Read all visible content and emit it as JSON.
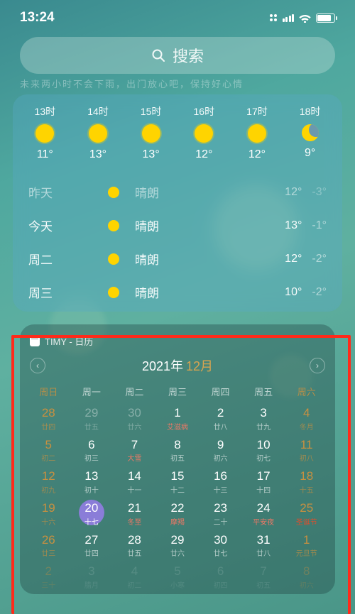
{
  "status": {
    "time": "13:24"
  },
  "search": {
    "placeholder": "搜索"
  },
  "weather": {
    "faded": "未来两小时不会下雨，出门放心吧，保持好心情",
    "hourly": [
      {
        "t": "13时",
        "temp": "11°",
        "icon": "sun"
      },
      {
        "t": "14时",
        "temp": "13°",
        "icon": "sun"
      },
      {
        "t": "15时",
        "temp": "13°",
        "icon": "sun"
      },
      {
        "t": "16时",
        "temp": "12°",
        "icon": "sun"
      },
      {
        "t": "17时",
        "temp": "12°",
        "icon": "sun"
      },
      {
        "t": "18时",
        "temp": "9°",
        "icon": "moon"
      }
    ],
    "daily": [
      {
        "name": "昨天",
        "cond": "晴朗",
        "hi": "12°",
        "lo": "-3°",
        "muted": true
      },
      {
        "name": "今天",
        "cond": "晴朗",
        "hi": "13°",
        "lo": "-1°"
      },
      {
        "name": "周二",
        "cond": "晴朗",
        "hi": "12°",
        "lo": "-2°"
      },
      {
        "name": "周三",
        "cond": "晴朗",
        "hi": "10°",
        "lo": "-2°"
      }
    ]
  },
  "calendar": {
    "app": "TIMY - 日历",
    "year": "2021年",
    "month": "12月",
    "dow": [
      "周日",
      "周一",
      "周二",
      "周三",
      "周四",
      "周五",
      "周六"
    ],
    "cells": [
      {
        "n": "28",
        "s": "廿四",
        "cls": "dim weekend"
      },
      {
        "n": "29",
        "s": "廿五",
        "cls": "dim"
      },
      {
        "n": "30",
        "s": "廿六",
        "cls": "dim"
      },
      {
        "n": "1",
        "s": "艾滋病",
        "cls": "",
        "sub": "event"
      },
      {
        "n": "2",
        "s": "廿八",
        "cls": ""
      },
      {
        "n": "3",
        "s": "廿九",
        "cls": ""
      },
      {
        "n": "4",
        "s": "冬月",
        "cls": "weekend"
      },
      {
        "n": "5",
        "s": "初二",
        "cls": "weekend"
      },
      {
        "n": "6",
        "s": "初三",
        "cls": ""
      },
      {
        "n": "7",
        "s": "大雪",
        "cls": "",
        "sub": "event"
      },
      {
        "n": "8",
        "s": "初五",
        "cls": ""
      },
      {
        "n": "9",
        "s": "初六",
        "cls": ""
      },
      {
        "n": "10",
        "s": "初七",
        "cls": ""
      },
      {
        "n": "11",
        "s": "初八",
        "cls": "weekend"
      },
      {
        "n": "12",
        "s": "初九",
        "cls": "weekend"
      },
      {
        "n": "13",
        "s": "初十",
        "cls": ""
      },
      {
        "n": "14",
        "s": "十一",
        "cls": ""
      },
      {
        "n": "15",
        "s": "十二",
        "cls": ""
      },
      {
        "n": "16",
        "s": "十三",
        "cls": ""
      },
      {
        "n": "17",
        "s": "十四",
        "cls": ""
      },
      {
        "n": "18",
        "s": "十五",
        "cls": "weekend"
      },
      {
        "n": "19",
        "s": "十六",
        "cls": "weekend"
      },
      {
        "n": "20",
        "s": "十七",
        "cls": "today"
      },
      {
        "n": "21",
        "s": "冬至",
        "cls": "",
        "sub": "event"
      },
      {
        "n": "22",
        "s": "摩羯",
        "cls": "",
        "sub": "event"
      },
      {
        "n": "23",
        "s": "二十",
        "cls": ""
      },
      {
        "n": "24",
        "s": "平安夜",
        "cls": "",
        "sub": "event"
      },
      {
        "n": "25",
        "s": "圣诞节",
        "cls": "special"
      },
      {
        "n": "26",
        "s": "廿三",
        "cls": "weekend"
      },
      {
        "n": "27",
        "s": "廿四",
        "cls": ""
      },
      {
        "n": "28",
        "s": "廿五",
        "cls": ""
      },
      {
        "n": "29",
        "s": "廿六",
        "cls": ""
      },
      {
        "n": "30",
        "s": "廿七",
        "cls": ""
      },
      {
        "n": "31",
        "s": "廿八",
        "cls": ""
      },
      {
        "n": "1",
        "s": "元旦节",
        "cls": "dim weekend",
        "sub": "event"
      },
      {
        "n": "2",
        "s": "三十",
        "cls": "dim weekend fade"
      },
      {
        "n": "3",
        "s": "腊月",
        "cls": "dim fade"
      },
      {
        "n": "4",
        "s": "初二",
        "cls": "dim fade"
      },
      {
        "n": "5",
        "s": "小寒",
        "cls": "dim fade",
        "sub": "event"
      },
      {
        "n": "6",
        "s": "初四",
        "cls": "dim fade"
      },
      {
        "n": "7",
        "s": "初五",
        "cls": "dim fade"
      },
      {
        "n": "8",
        "s": "初六",
        "cls": "dim weekend fade"
      }
    ]
  }
}
